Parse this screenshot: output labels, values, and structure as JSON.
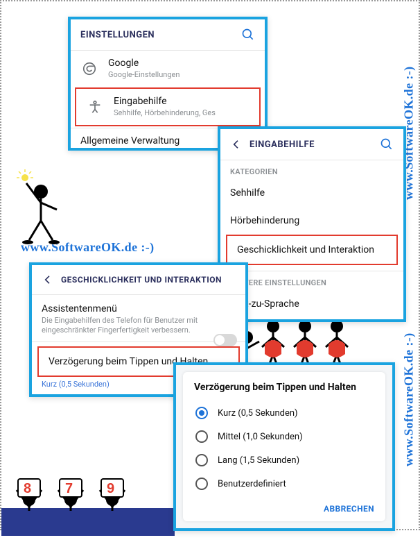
{
  "watermark": "www.SoftwareOK.de :-)",
  "panel1": {
    "title": "EINSTELLUNGEN",
    "items": [
      {
        "label": "Google",
        "sub": "Google-Einstellungen"
      },
      {
        "label": "Eingabehilfe",
        "sub": "Sehhilfe, Hörbehinderung, Ges"
      }
    ],
    "cut": "Allgemeine Verwaltung"
  },
  "panel2": {
    "title": "EINGABEHILFE",
    "section1": "KATEGORIEN",
    "items": [
      "Sehhilfe",
      "Hörbehinderung",
      "Geschicklichkeit und Interaktion"
    ],
    "section2": "WEITERE EINSTELLUNGEN",
    "items2": [
      "Text-zu-Sprache"
    ]
  },
  "panel3": {
    "title": "GESCHICKLICHKEIT UND INTERAKTION",
    "assist_label": "Assistentenmenü",
    "assist_desc": "Die Eingabehilfen des Telefon für Benutzer mit eingeschränkter Fingerfertigkeit verbessern.",
    "delay_label": "Verzögerung beim Tippen und Halten",
    "delay_value": "Kurz (0,5 Sekunden)"
  },
  "dialog": {
    "title": "Verzögerung beim Tippen und Halten",
    "options": [
      {
        "label": "Kurz (0,5 Sekunden)",
        "selected": true
      },
      {
        "label": "Mittel (1,0 Sekunden)",
        "selected": false
      },
      {
        "label": "Lang (1,5 Sekunden)",
        "selected": false
      },
      {
        "label": "Benutzerdefiniert",
        "selected": false
      }
    ],
    "cancel": "ABBRECHEN"
  },
  "judges": [
    "8",
    "7",
    "9"
  ]
}
